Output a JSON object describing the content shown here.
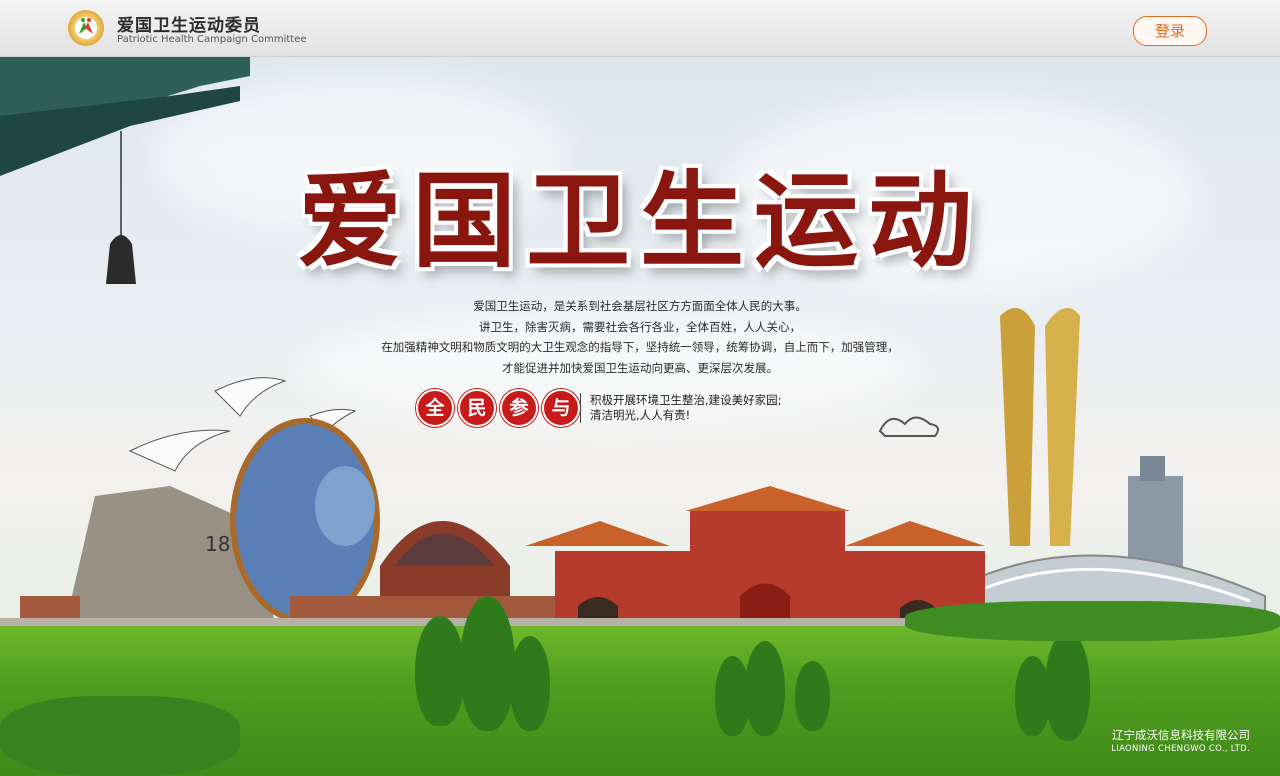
{
  "header": {
    "org_name_cn": "爱国卫生运动委员",
    "org_name_en": "Patriotic Health Campaign Committee",
    "login_label": "登录"
  },
  "banner": {
    "title": "爱国卫生运动",
    "intro_lines": [
      "爱国卫生运动，是关系到社会基层社区方方面面全体人民的大事。",
      "讲卫生，除害灭病，需要社会各行各业，全体百姓，人人关心，",
      "在加强精神文明和物质文明的大卫生观念的指导下，坚持统一领导，统筹协调，自上而下，加强管理，",
      "才能促进并加快爱国卫生运动向更高、更深层次发展。"
    ],
    "seals": [
      "全",
      "民",
      "参",
      "与"
    ],
    "slogan_lines": [
      "积极开展环境卫生整治,建设美好家园;",
      "清洁明光,人人有责!"
    ],
    "seal_sign_18": "18"
  },
  "footer": {
    "company_cn": "辽宁成沃信息科技有限公司",
    "company_en": "LIAONING CHENGWO CO., LTD."
  },
  "colors": {
    "accent": "#e56a1f",
    "title_red": "#8a1610",
    "seal_red": "#c81a1a",
    "grass_green": "#4f9c1e"
  }
}
